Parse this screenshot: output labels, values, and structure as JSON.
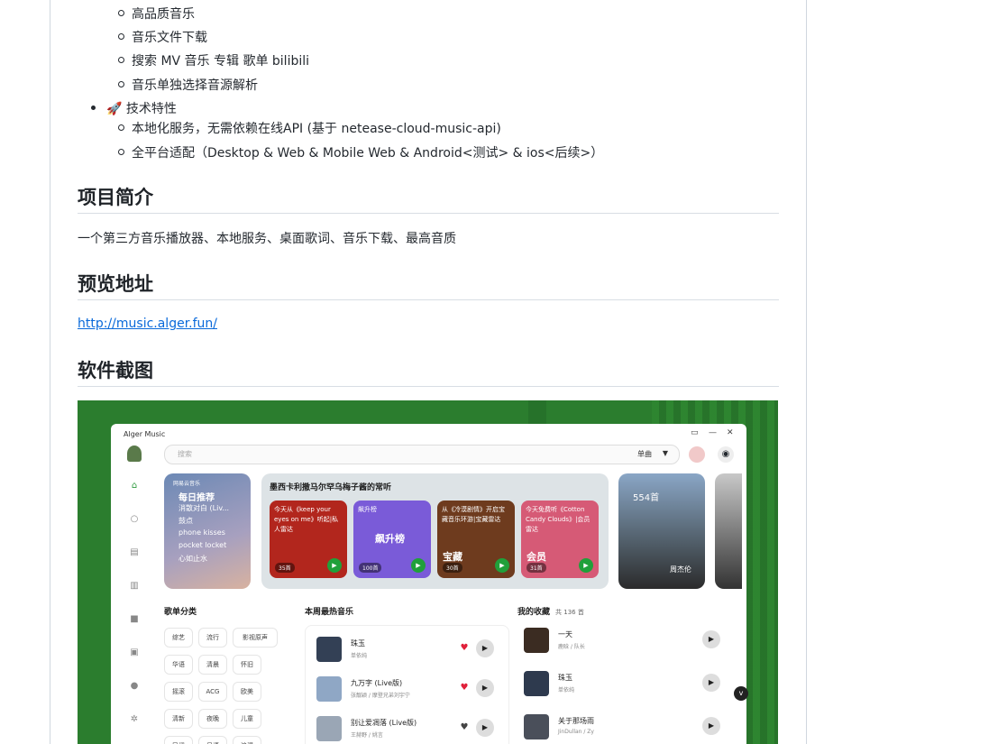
{
  "features": {
    "sub1": [
      "高品质音乐",
      "音乐文件下载",
      "搜索 MV 音乐 专辑 歌单 bilibili",
      "音乐单独选择音源解析"
    ],
    "tech_title": "🚀 技术特性",
    "tech_items": [
      "本地化服务，无需依赖在线API (基于 netease-cloud-music-api)",
      "全平台适配（Desktop & Web & Mobile Web & Android<测试> & ios<后续>）"
    ]
  },
  "sections": {
    "intro_title": "项目简介",
    "intro_text": "一个第三方音乐播放器、本地服务、桌面歌词、音乐下载、最高音质",
    "preview_title": "预览地址",
    "preview_link": "http://music.alger.fun/",
    "shots_title": "软件截图"
  },
  "app": {
    "title": "Alger Music",
    "search_placeholder": "搜索",
    "search_mode": "单曲",
    "daily": {
      "brand": "网易云音乐",
      "title": "每日推荐",
      "songs": [
        "消散对白 (Liv...",
        "鼓点",
        "phone kisses",
        "pocket locket",
        "心如止水"
      ]
    },
    "mid_title": "墨西卡利撒马尔罕乌梅子酱的常听",
    "cards": [
      {
        "text": "今天从《keep your eyes on me》听起|私人雷达",
        "count": "35首",
        "color": "#b2261d"
      },
      {
        "text": "飙升榜",
        "big": "飙升榜",
        "count": "100首",
        "color": "#7a5bd8"
      },
      {
        "text": "从《冷漠剧情》开启宝藏音乐环游|宝藏雷达",
        "big": "宝藏",
        "count": "30首",
        "color": "#6e3b1e"
      },
      {
        "text": "今天免费听《Cotton Candy Clouds》|会员雷达",
        "big": "会员",
        "count": "31首",
        "color": "#d65a76"
      }
    ],
    "artist": {
      "count": "554首",
      "name": "周杰伦"
    },
    "cat_title": "歌单分类",
    "categories": [
      "综艺",
      "流行",
      "影视原声",
      "华语",
      "清晨",
      "怀旧",
      "摇滚",
      "ACG",
      "欧美",
      "清新",
      "夜晚",
      "儿童",
      "民谣",
      "日语",
      "浪漫"
    ],
    "hot_title": "本周最热音乐",
    "hot": [
      {
        "title": "珠玉",
        "sub": "单依纯",
        "liked": true
      },
      {
        "title": "九万字 (Live版)",
        "sub": "张靓颖 / 摩登兄弟刘宇宁",
        "liked": true
      },
      {
        "title": "别让爱凋落 (Live版)",
        "sub": "王赫野 / 姚言",
        "liked": false
      }
    ],
    "fav_title": "我的收藏",
    "fav_count": "共 136 首",
    "favs": [
      {
        "title": "一天",
        "sub": "鹿晗 / 队长"
      },
      {
        "title": "珠玉",
        "sub": "单依纯"
      },
      {
        "title": "关于那场雨",
        "sub": "JinDullan / Zy"
      }
    ]
  }
}
